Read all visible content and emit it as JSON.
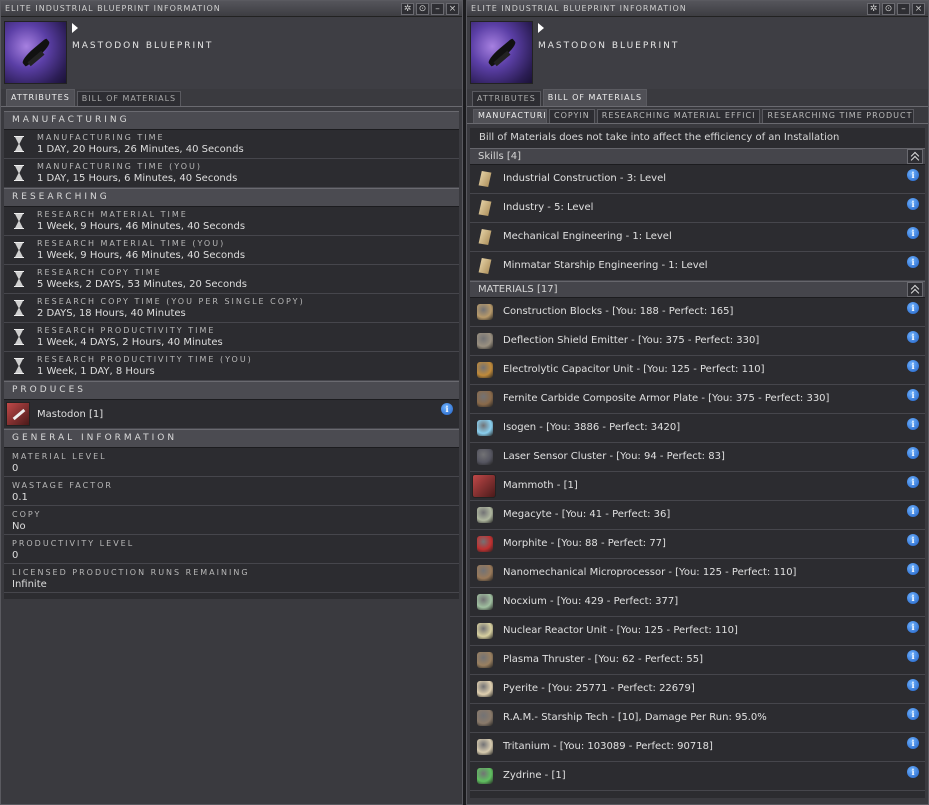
{
  "left": {
    "title": "ELITE INDUSTRIAL BLUEPRINT INFORMATION",
    "item_name": "MASTODON BLUEPRINT",
    "tabs": [
      "ATTRIBUTES",
      "BILL OF MATERIALS"
    ],
    "manufacturing_header": "MANUFACTURING",
    "manufacturing": [
      {
        "label": "MANUFACTURING TIME",
        "value": "1 DAY, 20 Hours, 26 Minutes, 40 Seconds"
      },
      {
        "label": "MANUFACTURING TIME (YOU)",
        "value": "1 DAY, 15 Hours, 6 Minutes, 40 Seconds"
      }
    ],
    "researching_header": "RESEARCHING",
    "researching": [
      {
        "label": "RESEARCH MATERIAL TIME",
        "value": "1 Week, 9 Hours, 46 Minutes, 40 Seconds"
      },
      {
        "label": "RESEARCH MATERIAL TIME (YOU)",
        "value": "1 Week, 9 Hours, 46 Minutes, 40 Seconds"
      },
      {
        "label": "RESEARCH COPY TIME",
        "value": "5 Weeks, 2 DAYS, 53 Minutes, 20 Seconds"
      },
      {
        "label": "RESEARCH COPY TIME (YOU PER SINGLE COPY)",
        "value": "2 DAYS, 18 Hours, 40 Minutes"
      },
      {
        "label": "RESEARCH PRODUCTIVITY TIME",
        "value": "1 Week, 4 DAYS, 2 Hours, 40 Minutes"
      },
      {
        "label": "RESEARCH PRODUCTIVITY TIME (YOU)",
        "value": "1 Week, 1 DAY, 8 Hours"
      }
    ],
    "produces_header": "PRODUCES",
    "produces_item": "Mastodon [1]",
    "general_header": "GENERAL INFORMATION",
    "general": [
      {
        "label": "MATERIAL LEVEL",
        "value": "0"
      },
      {
        "label": "WASTAGE FACTOR",
        "value": "0.1"
      },
      {
        "label": "COPY",
        "value": "No"
      },
      {
        "label": "PRODUCTIVITY LEVEL",
        "value": "0"
      },
      {
        "label": "LICENSED PRODUCTION RUNS REMAINING",
        "value": "Infinite"
      }
    ]
  },
  "right": {
    "title": "ELITE INDUSTRIAL BLUEPRINT INFORMATION",
    "item_name": "MASTODON BLUEPRINT",
    "tabs": [
      "ATTRIBUTES",
      "BILL OF MATERIALS"
    ],
    "subtabs": [
      "MANUFACTURI",
      "COPYIN",
      "RESEARCHING MATERIAL EFFICI",
      "RESEARCHING TIME PRODUCTI"
    ],
    "note": "Bill of Materials does not take into affect the efficiency of an Installation",
    "skills_header": "Skills [4]",
    "skills": [
      "Industrial Construction - 3: Level",
      "Industry - 5: Level",
      "Mechanical Engineering - 1: Level",
      "Minmatar Starship Engineering - 1: Level"
    ],
    "materials_header": "MATERIALS [17]",
    "materials": [
      {
        "text": "Construction Blocks - [You: 188 - Perfect: 165]",
        "icon": "construction-blocks-icon",
        "color": "#b89a6a"
      },
      {
        "text": "Deflection Shield Emitter - [You: 375 - Perfect: 330]",
        "icon": "shield-emitter-icon",
        "color": "#9a9080"
      },
      {
        "text": "Electrolytic Capacitor Unit - [You: 125 - Perfect: 110]",
        "icon": "capacitor-unit-icon",
        "color": "#c08a3a"
      },
      {
        "text": "Fernite Carbide Composite Armor Plate - [You: 375 - Perfect: 330]",
        "icon": "armor-plate-icon",
        "color": "#8a6a4a"
      },
      {
        "text": "Isogen - [You: 3886 - Perfect: 3420]",
        "icon": "isogen-icon",
        "color": "#8ad0f0"
      },
      {
        "text": "Laser Sensor Cluster - [You: 94 - Perfect: 83]",
        "icon": "sensor-cluster-icon",
        "color": "#555560"
      },
      {
        "text": "Mammoth - [1]",
        "icon": "mammoth-ship-icon",
        "color": "#c04848"
      },
      {
        "text": "Megacyte - [You: 41 - Perfect: 36]",
        "icon": "megacyte-icon",
        "color": "#b0b8a0"
      },
      {
        "text": "Morphite - [You: 88 - Perfect: 77]",
        "icon": "morphite-icon",
        "color": "#c03030"
      },
      {
        "text": "Nanomechanical Microprocessor - [You: 125 - Perfect: 110]",
        "icon": "microprocessor-icon",
        "color": "#9a7a5a"
      },
      {
        "text": "Nocxium - [You: 429 - Perfect: 377]",
        "icon": "nocxium-icon",
        "color": "#a0c0a0"
      },
      {
        "text": "Nuclear Reactor Unit - [You: 125 - Perfect: 110]",
        "icon": "reactor-unit-icon",
        "color": "#d8d0a0"
      },
      {
        "text": "Plasma Thruster - [You: 62 - Perfect: 55]",
        "icon": "plasma-thruster-icon",
        "color": "#9a8060"
      },
      {
        "text": "Pyerite - [You: 25771 - Perfect: 22679]",
        "icon": "pyerite-icon",
        "color": "#e0d0b0"
      },
      {
        "text": "R.A.M.- Starship Tech - [10], Damage Per Run: 95.0%",
        "icon": "ram-starship-tech-icon",
        "color": "#8a7a6a"
      },
      {
        "text": "Tritanium - [You: 103089 - Perfect: 90718]",
        "icon": "tritanium-icon",
        "color": "#d8ccb0"
      },
      {
        "text": "Zydrine - [1]",
        "icon": "zydrine-icon",
        "color": "#60c060"
      }
    ]
  }
}
